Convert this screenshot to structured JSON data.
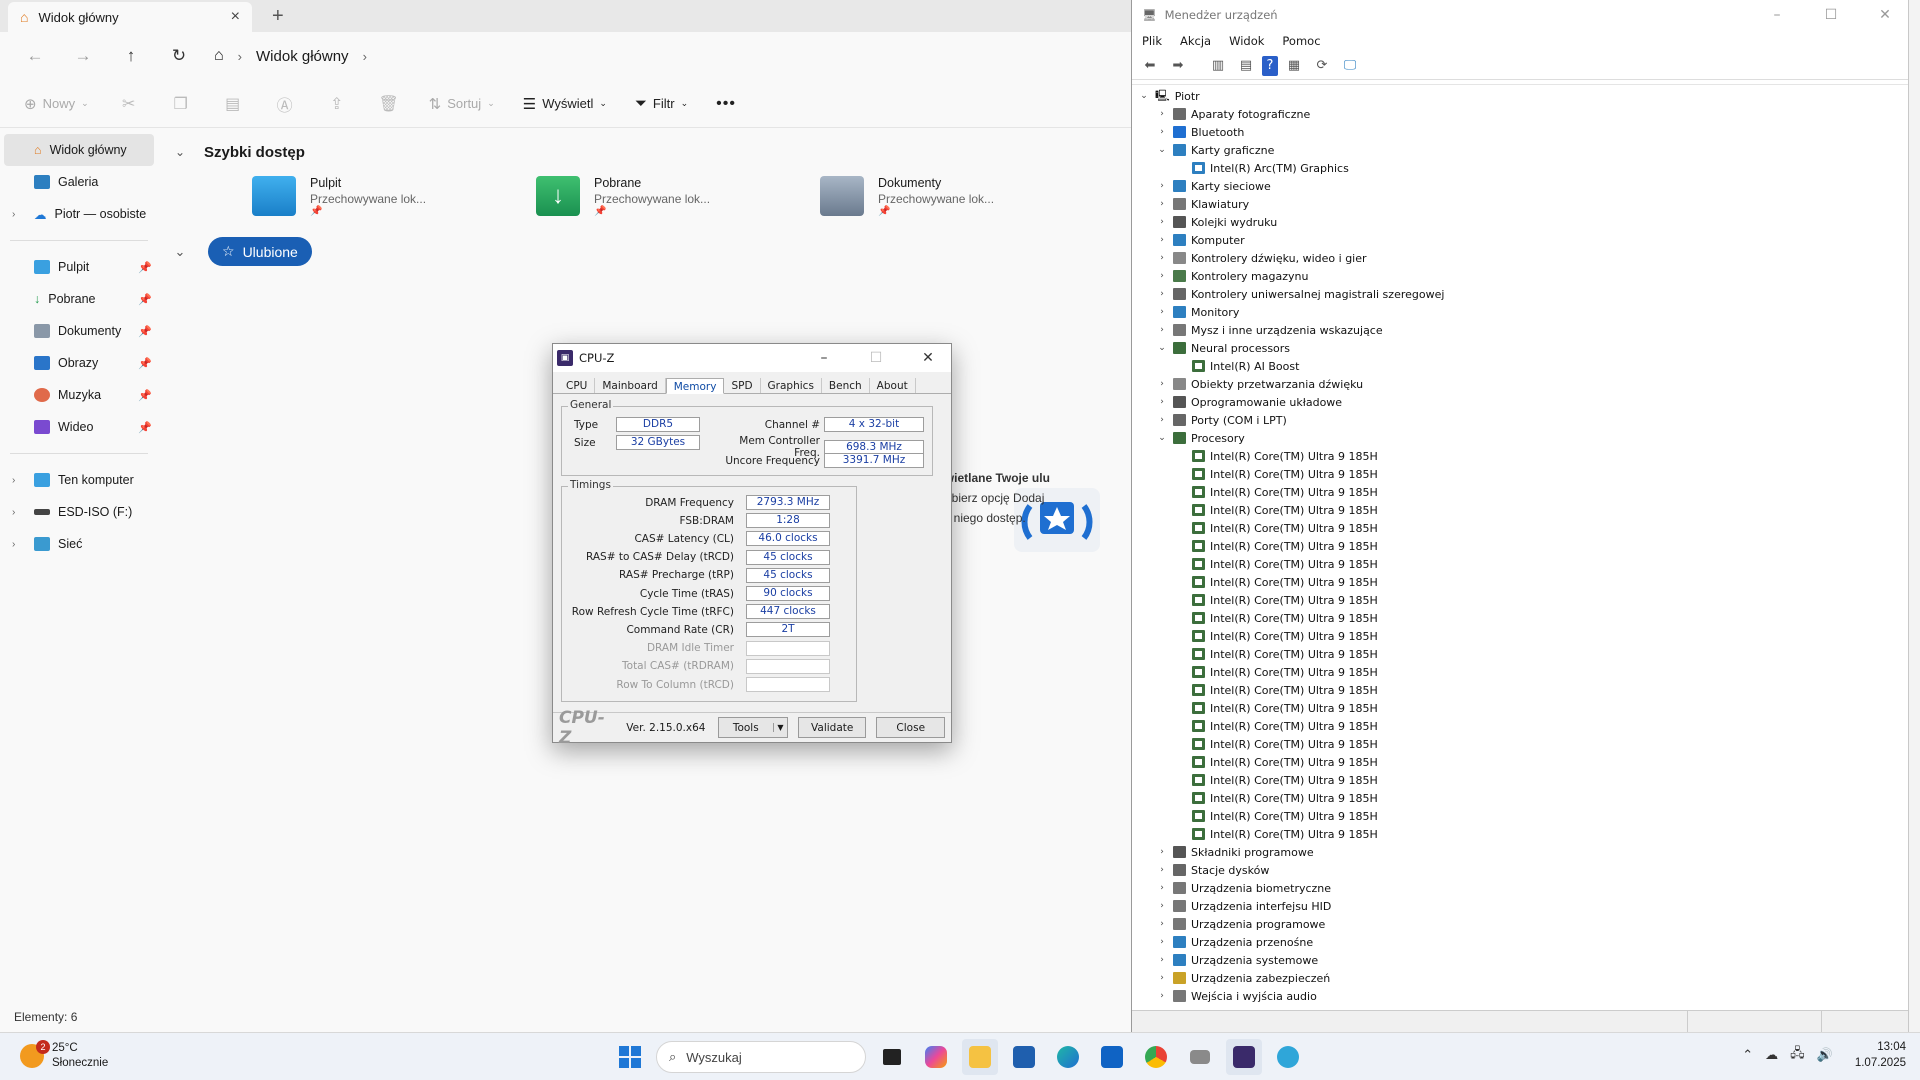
{
  "explorer": {
    "tab_title": "Widok główny",
    "breadcrumb": [
      "Widok główny"
    ],
    "toolbar": {
      "new": "Nowy",
      "sort": "Sortuj",
      "view": "Wyświetl",
      "filter": "Filtr"
    },
    "sidebar": {
      "home": "Widok główny",
      "gallery": "Galeria",
      "onedrive": "Piotr — osobiste",
      "pinned": [
        "Pulpit",
        "Pobrane",
        "Dokumenty",
        "Obrazy",
        "Muzyka",
        "Wideo"
      ],
      "thispc": "Ten komputer",
      "usb": "ESD-ISO (F:)",
      "network": "Sieć"
    },
    "quick_access_title": "Szybki dostęp",
    "quick_items": [
      {
        "name": "Pulpit",
        "sub": "Przechowywane lok..."
      },
      {
        "name": "Pobrane",
        "sub": "Przechowywane lok..."
      },
      {
        "name": "Dokumenty",
        "sub": "Przechowywane lok..."
      }
    ],
    "favorites_label": "Ulubione",
    "empty_line1": "utaj będą wyświetlane Twoje ulu",
    "empty_line2": "a następnie wybierz opcję Dodaj",
    "empty_line3": "uzyskać do niego dostęp.",
    "status": "Elementy: 6"
  },
  "cpuz": {
    "title": "CPU-Z",
    "tabs": [
      "CPU",
      "Mainboard",
      "Memory",
      "SPD",
      "Graphics",
      "Bench",
      "About"
    ],
    "active_tab": "Memory",
    "general_label": "General",
    "general": {
      "type_label": "Type",
      "type": "DDR5",
      "size_label": "Size",
      "size": "32 GBytes",
      "channel_label": "Channel #",
      "channel": "4 x 32-bit",
      "mcf_label": "Mem Controller Freq.",
      "mcf": "698.3 MHz",
      "uncore_label": "Uncore Frequency",
      "uncore": "3391.7 MHz"
    },
    "timings_label": "Timings",
    "timings": [
      {
        "label": "DRAM Frequency",
        "value": "2793.3 MHz",
        "dim": false
      },
      {
        "label": "FSB:DRAM",
        "value": "1:28",
        "dim": false
      },
      {
        "label": "CAS# Latency (CL)",
        "value": "46.0 clocks",
        "dim": false
      },
      {
        "label": "RAS# to CAS# Delay (tRCD)",
        "value": "45 clocks",
        "dim": false
      },
      {
        "label": "RAS# Precharge (tRP)",
        "value": "45 clocks",
        "dim": false
      },
      {
        "label": "Cycle Time (tRAS)",
        "value": "90 clocks",
        "dim": false
      },
      {
        "label": "Row Refresh Cycle Time (tRFC)",
        "value": "447 clocks",
        "dim": false
      },
      {
        "label": "Command Rate (CR)",
        "value": "2T",
        "dim": false
      },
      {
        "label": "DRAM Idle Timer",
        "value": "",
        "dim": true
      },
      {
        "label": "Total CAS# (tRDRAM)",
        "value": "",
        "dim": true
      },
      {
        "label": "Row To Column (tRCD)",
        "value": "",
        "dim": true
      }
    ],
    "brand": "CPU-Z",
    "version": "Ver. 2.15.0.x64",
    "tools": "Tools",
    "validate": "Validate",
    "close": "Close"
  },
  "devmgr": {
    "title": "Menedżer urządzeń",
    "menu": [
      "Plik",
      "Akcja",
      "Widok",
      "Pomoc"
    ],
    "root": "Piotr",
    "nodes": [
      {
        "label": "Aparaty fotograficzne",
        "open": false,
        "color": "#6a6a6a"
      },
      {
        "label": "Bluetooth",
        "open": false,
        "color": "#1f6fd1"
      },
      {
        "label": "Karty graficzne",
        "open": true,
        "color": "#2d7fc0",
        "children": [
          "Intel(R) Arc(TM) Graphics"
        ]
      },
      {
        "label": "Karty sieciowe",
        "open": false,
        "color": "#2d7fc0"
      },
      {
        "label": "Klawiatury",
        "open": false,
        "color": "#777777"
      },
      {
        "label": "Kolejki wydruku",
        "open": false,
        "color": "#555555"
      },
      {
        "label": "Komputer",
        "open": false,
        "color": "#2d7fc0"
      },
      {
        "label": "Kontrolery dźwięku, wideo i gier",
        "open": false,
        "color": "#888888"
      },
      {
        "label": "Kontrolery magazynu",
        "open": false,
        "color": "#4a7a4a"
      },
      {
        "label": "Kontrolery uniwersalnej magistrali szeregowej",
        "open": false,
        "color": "#666666"
      },
      {
        "label": "Monitory",
        "open": false,
        "color": "#2d7fc0"
      },
      {
        "label": "Mysz i inne urządzenia wskazujące",
        "open": false,
        "color": "#777777"
      },
      {
        "label": "Neural processors",
        "open": true,
        "color": "#3c6e3c",
        "children": [
          "Intel(R) AI Boost"
        ]
      },
      {
        "label": "Obiekty przetwarzania dźwięku",
        "open": false,
        "color": "#888888"
      },
      {
        "label": "Oprogramowanie układowe",
        "open": false,
        "color": "#555555"
      },
      {
        "label": "Porty (COM i LPT)",
        "open": false,
        "color": "#666666"
      },
      {
        "label": "Procesory",
        "open": true,
        "color": "#3c6e3c",
        "children": [
          "Intel(R) Core(TM) Ultra 9 185H",
          "Intel(R) Core(TM) Ultra 9 185H",
          "Intel(R) Core(TM) Ultra 9 185H",
          "Intel(R) Core(TM) Ultra 9 185H",
          "Intel(R) Core(TM) Ultra 9 185H",
          "Intel(R) Core(TM) Ultra 9 185H",
          "Intel(R) Core(TM) Ultra 9 185H",
          "Intel(R) Core(TM) Ultra 9 185H",
          "Intel(R) Core(TM) Ultra 9 185H",
          "Intel(R) Core(TM) Ultra 9 185H",
          "Intel(R) Core(TM) Ultra 9 185H",
          "Intel(R) Core(TM) Ultra 9 185H",
          "Intel(R) Core(TM) Ultra 9 185H",
          "Intel(R) Core(TM) Ultra 9 185H",
          "Intel(R) Core(TM) Ultra 9 185H",
          "Intel(R) Core(TM) Ultra 9 185H",
          "Intel(R) Core(TM) Ultra 9 185H",
          "Intel(R) Core(TM) Ultra 9 185H",
          "Intel(R) Core(TM) Ultra 9 185H",
          "Intel(R) Core(TM) Ultra 9 185H",
          "Intel(R) Core(TM) Ultra 9 185H",
          "Intel(R) Core(TM) Ultra 9 185H"
        ]
      },
      {
        "label": "Składniki programowe",
        "open": false,
        "color": "#555555"
      },
      {
        "label": "Stacje dysków",
        "open": false,
        "color": "#666666"
      },
      {
        "label": "Urządzenia biometryczne",
        "open": false,
        "color": "#777777"
      },
      {
        "label": "Urządzenia interfejsu HID",
        "open": false,
        "color": "#777777"
      },
      {
        "label": "Urządzenia programowe",
        "open": false,
        "color": "#777777"
      },
      {
        "label": "Urządzenia przenośne",
        "open": false,
        "color": "#2d7fc0"
      },
      {
        "label": "Urządzenia systemowe",
        "open": false,
        "color": "#2d7fc0"
      },
      {
        "label": "Urządzenia zabezpieczeń",
        "open": false,
        "color": "#c9a227"
      },
      {
        "label": "Wejścia i wyjścia audio",
        "open": false,
        "color": "#777777"
      }
    ]
  },
  "taskbar": {
    "temp": "25°C",
    "weather": "Słonecznie",
    "badge": "2",
    "search_placeholder": "Wyszukaj",
    "time": "13:04",
    "date": "1.07.2025"
  },
  "colors": {
    "accent": "#1a5fb4",
    "cpuz_value": "#1a3ea3"
  }
}
